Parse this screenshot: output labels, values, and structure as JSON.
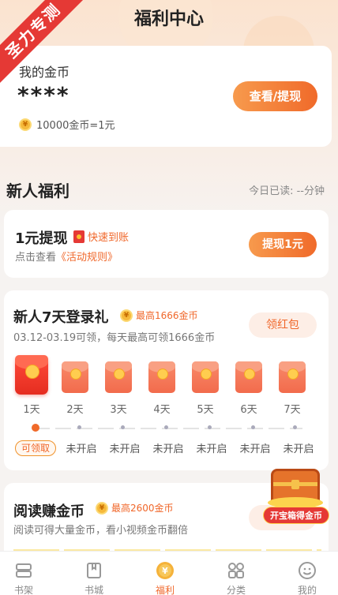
{
  "ribbon": "圣力专测",
  "header": {
    "title": "福利中心"
  },
  "coins": {
    "label": "我的金币",
    "value": "****",
    "rate": "10000金币=1元",
    "button": "查看/提现",
    "coin_icon_glyph": "¥"
  },
  "newbie": {
    "title": "新人福利",
    "today_read": "今日已读: --分钟"
  },
  "withdraw": {
    "title": "1元提现",
    "tag": "快速到账",
    "sub_prefix": "点击查看",
    "sub_link": "《活动规则》",
    "button": "提现1元"
  },
  "login": {
    "title": "新人7天登录礼",
    "tag": "最高1666金币",
    "sub": "03.12-03.19可领，每天最高可领1666金币",
    "button": "领红包",
    "days": [
      "1天",
      "2天",
      "3天",
      "4天",
      "5天",
      "6天",
      "7天"
    ],
    "statuses": [
      "可领取",
      "未开启",
      "未开启",
      "未开启",
      "未开启",
      "未开启",
      "未开启"
    ]
  },
  "reading": {
    "title": "阅读赚金币",
    "tag": "最高2600金币",
    "sub": "阅读可得大量金币，看小视频金币翻倍"
  },
  "chest": {
    "label": "开宝箱得金币"
  },
  "tabs": [
    {
      "label": "书架",
      "icon": "bookshelf-icon"
    },
    {
      "label": "书城",
      "icon": "bookstore-icon"
    },
    {
      "label": "福利",
      "icon": "welfare-icon"
    },
    {
      "label": "分类",
      "icon": "category-icon"
    },
    {
      "label": "我的",
      "icon": "profile-icon"
    }
  ],
  "colors": {
    "accent": "#f0672a",
    "ribbon": "#e53935",
    "coin": "#f6b93b"
  }
}
